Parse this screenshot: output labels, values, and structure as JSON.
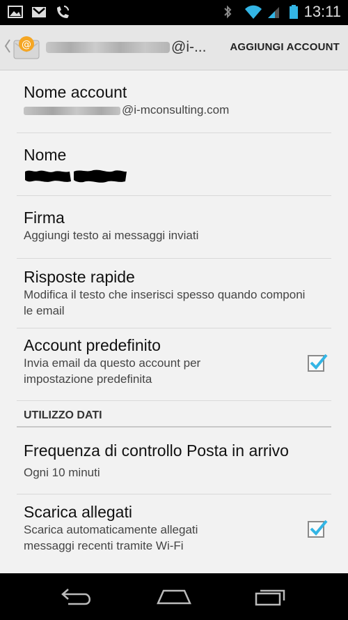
{
  "status_bar": {
    "time": "13:11",
    "icons": [
      "image-icon",
      "gmail-icon",
      "missed-call-icon",
      "bluetooth-icon",
      "wifi-icon",
      "signal-icon",
      "battery-icon"
    ]
  },
  "action_bar": {
    "account_suffix": "@i-...",
    "add_account_label": "AGGIUNGI ACCOUNT"
  },
  "settings": {
    "account_name": {
      "title": "Nome account",
      "value_suffix": "@i-mconsulting.com"
    },
    "name": {
      "title": "Nome"
    },
    "signature": {
      "title": "Firma",
      "summary": "Aggiungi testo ai messaggi inviati"
    },
    "quick_responses": {
      "title": "Risposte rapide",
      "summary": "Modifica il testo che inserisci spesso quando componi le email"
    },
    "default_account": {
      "title": "Account predefinito",
      "summary": "Invia email da questo account per impostazione predefinita",
      "checked": true
    },
    "data_usage_header": "UTILIZZO DATI",
    "inbox_check_frequency": {
      "title": "Frequenza di controllo Posta in arrivo",
      "summary": "Ogni 10 minuti"
    },
    "download_attachments": {
      "title": "Scarica allegati",
      "summary": "Scarica automaticamente allegati messaggi recenti tramite Wi-Fi",
      "checked": true
    }
  },
  "colors": {
    "accent": "#33b5e5",
    "background": "#f2f2f2",
    "divider": "#d9d9d9"
  }
}
